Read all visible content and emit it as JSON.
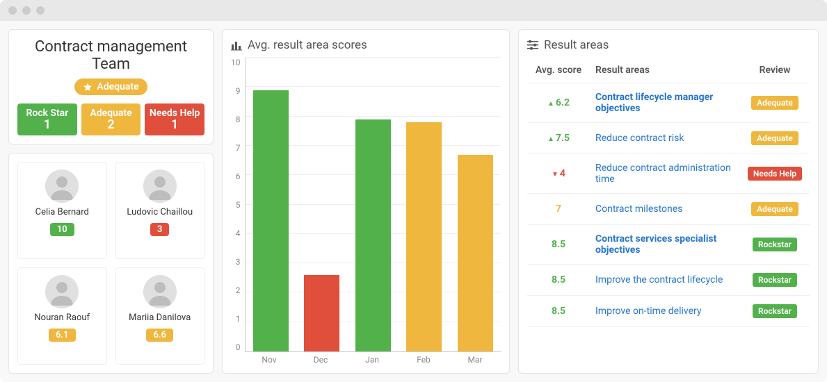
{
  "team": {
    "title": "Contract management Team",
    "status_label": "Adequate",
    "summary": [
      {
        "label": "Rock Star",
        "count": "1",
        "color": "#53b14c"
      },
      {
        "label": "Adequate",
        "count": "2",
        "color": "#efb73e"
      },
      {
        "label": "Needs Help",
        "count": "1",
        "color": "#e04f3c"
      }
    ],
    "members": [
      {
        "name": "Celia Bernard",
        "score": "10",
        "color": "#53b14c"
      },
      {
        "name": "Ludovic Chaillou",
        "score": "3",
        "color": "#e04f3c"
      },
      {
        "name": "Nouran Raouf",
        "score": "6.1",
        "color": "#efb73e"
      },
      {
        "name": "Mariia Danilova",
        "score": "6.6",
        "color": "#efb73e"
      }
    ]
  },
  "chart_panel_title": "Avg. result area scores",
  "chart_data": {
    "type": "bar",
    "title": "Avg. result area scores",
    "categories": [
      "Nov",
      "Dec",
      "Jan",
      "Feb",
      "Mar"
    ],
    "values": [
      8.9,
      2.6,
      7.9,
      7.8,
      6.7
    ],
    "colors": [
      "#53b14c",
      "#e04f3c",
      "#53b14c",
      "#efb73e",
      "#efb73e"
    ],
    "ylim": [
      0,
      10
    ],
    "yticks": [
      0,
      1,
      2,
      3,
      4,
      5,
      6,
      7,
      8,
      9,
      10
    ],
    "xlabel": "",
    "ylabel": ""
  },
  "result_areas": {
    "panel_title": "Result areas",
    "headers": {
      "score": "Avg. score",
      "area": "Result areas",
      "review": "Review"
    },
    "rows": [
      {
        "score": "6.2",
        "score_class": "score-green",
        "trend": "up",
        "area": "Contract lifecycle manager objectives",
        "bold": true,
        "review": "Adequate",
        "review_color": "#efb73e"
      },
      {
        "score": "7.5",
        "score_class": "score-green",
        "trend": "up",
        "area": "Reduce contract risk",
        "bold": false,
        "review": "Adequate",
        "review_color": "#efb73e"
      },
      {
        "score": "4",
        "score_class": "score-red",
        "trend": "down",
        "area": "Reduce contract administration time",
        "bold": false,
        "review": "Needs Help",
        "review_color": "#e04f3c"
      },
      {
        "score": "7",
        "score_class": "score-yellow",
        "trend": "",
        "area": "Contract milestones",
        "bold": false,
        "review": "Adequate",
        "review_color": "#efb73e"
      },
      {
        "score": "8.5",
        "score_class": "score-green",
        "trend": "",
        "area": "Contract services specialist objectives",
        "bold": true,
        "review": "Rockstar",
        "review_color": "#53b14c"
      },
      {
        "score": "8.5",
        "score_class": "score-green",
        "trend": "",
        "area": "Improve the contract lifecycle",
        "bold": false,
        "review": "Rockstar",
        "review_color": "#53b14c"
      },
      {
        "score": "8.5",
        "score_class": "score-green",
        "trend": "",
        "area": "Improve on-time delivery",
        "bold": false,
        "review": "Rockstar",
        "review_color": "#53b14c"
      }
    ]
  }
}
